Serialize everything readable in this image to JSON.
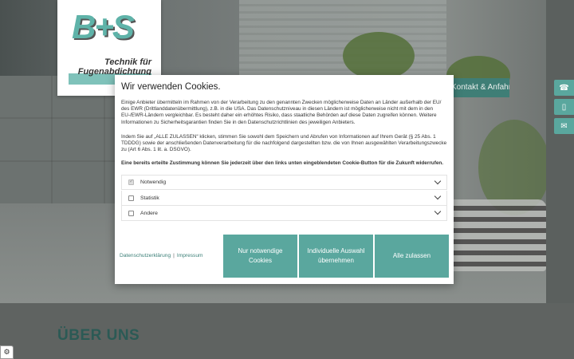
{
  "logo": {
    "mark": "B+S",
    "tagline": "Technik für Fugenabdichtung"
  },
  "nav": {
    "contact": "Kontakt & Anfahrt"
  },
  "side_buttons": {
    "phone": "phone-icon",
    "mobile": "mobile-icon",
    "mail": "mail-icon"
  },
  "section": {
    "about_title": "ÜBER UNS"
  },
  "cookie": {
    "title": "Wir verwenden Cookies.",
    "text1": "Einige Anbieter übermitteln im Rahmen von der Verarbeitung zu den genannten Zwecken möglicherweise Daten an Länder außerhalb der EU/ des EWR (Drittlanddatenübermittlung), z.B. in die USA. Das Datenschutzniveau in diesen Ländern ist möglicherweise nicht mit dem in den EU-/EWR-Ländern vergleichbar. Es besteht daher ein erhöhtes Risiko, dass staatliche Behörden auf diese Daten zugreifen können. Weitere Informationen zu Sicherheitsgarantien finden Sie in den Datenschutzrichtlinien des jeweiligen Anbieters.",
    "text2": "Indem Sie auf „ALLE ZULASSEN“ klicken, stimmen Sie sowohl dem Speichern und Abrufen von Informationen auf Ihrem Gerät (§ 25 Abs. 1 TDDDG) sowie der anschließenden Datenverarbeitung für die nachfolgend dargestellten bzw. die von Ihnen ausgewählten Verarbeitungszwecke zu (Art 6 Abs. 1 lit. a. DSGVO).",
    "text3": "Eine bereits erteilte Zustimmung können Sie jederzeit über den links unten eingeblendeten Cookie-Button für die Zukunft widerrufen.",
    "categories": [
      {
        "label": "Notwendig",
        "checked": true
      },
      {
        "label": "Statistik",
        "checked": false
      },
      {
        "label": "Andere",
        "checked": false
      }
    ],
    "links": {
      "privacy": "Datenschutzerklärung",
      "separator": "|",
      "imprint": "Impressum"
    },
    "buttons": {
      "necessary": "Nur notwendige Cookies",
      "individual": "Individuelle Auswahl übernehmen",
      "accept_all": "Alle zulassen"
    }
  },
  "colors": {
    "accent": "#5aa79e",
    "heading": "#2b5a55"
  }
}
